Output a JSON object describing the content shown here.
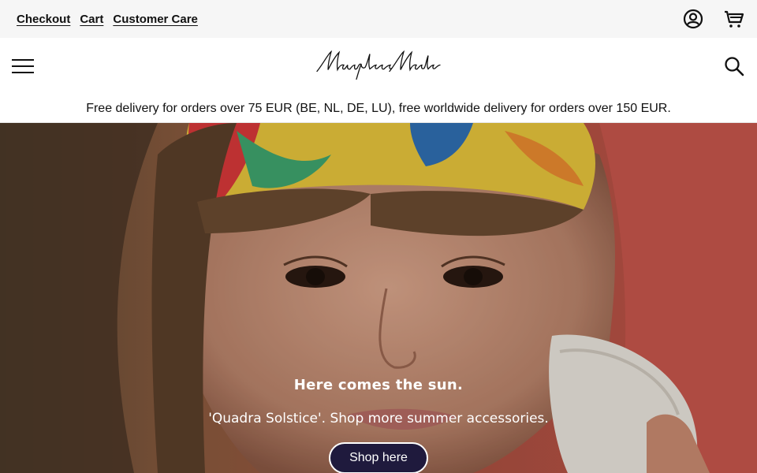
{
  "utility_bar": {
    "links": [
      "Checkout",
      "Cart",
      "Customer Care"
    ],
    "icons": [
      "account-icon",
      "shopping-cart-icon"
    ]
  },
  "header": {
    "menu_icon": "hamburger-menu-icon",
    "logo_text": "Marylène Madou",
    "search_icon": "search-icon"
  },
  "announcement": "Free delivery for orders over 75 EUR (BE, NL, DE, LU), free worldwide delivery for orders over 150 EUR.",
  "hero": {
    "title": "Here comes the sun.",
    "subtitle": "'Quadra Solstice'. Shop more summer accessories.",
    "button_label": "Shop here"
  },
  "colors": {
    "utility_bg": "#f6f6f6",
    "button_bg": "#1f1a3d",
    "hero_bg": "#c0504a"
  }
}
